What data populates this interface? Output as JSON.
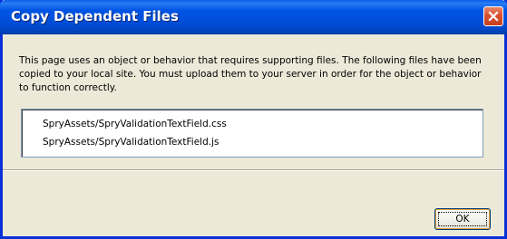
{
  "dialog": {
    "title": "Copy Dependent Files",
    "message": "This page uses an object or behavior that requires supporting files. The following files have been copied to your local site. You must upload them to your server in order for the object or behavior to function correctly.",
    "files": [
      "SpryAssets/SpryValidationTextField.css",
      "SpryAssets/SpryValidationTextField.js"
    ],
    "ok_label": "OK"
  },
  "icons": {
    "close": "close-icon"
  },
  "colors": {
    "titlebar": "#0054e3",
    "window_border": "#0831d9",
    "dialog_background": "#ece9d8",
    "close_button": "#d8502f"
  }
}
